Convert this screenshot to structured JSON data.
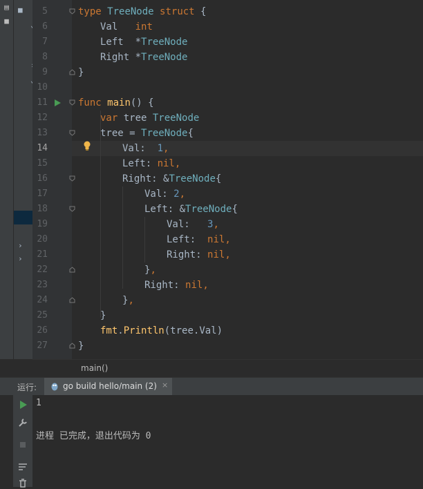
{
  "editor": {
    "lines": [
      {
        "n": "5"
      },
      {
        "n": "6"
      },
      {
        "n": "7"
      },
      {
        "n": "8"
      },
      {
        "n": "9"
      },
      {
        "n": "10"
      },
      {
        "n": "11"
      },
      {
        "n": "12"
      },
      {
        "n": "13"
      },
      {
        "n": "14"
      },
      {
        "n": "15"
      },
      {
        "n": "16"
      },
      {
        "n": "17"
      },
      {
        "n": "18"
      },
      {
        "n": "19"
      },
      {
        "n": "20"
      },
      {
        "n": "21"
      },
      {
        "n": "22"
      },
      {
        "n": "23"
      },
      {
        "n": "24"
      },
      {
        "n": "25"
      },
      {
        "n": "26"
      },
      {
        "n": "27"
      }
    ],
    "tokens": {
      "t_type": "type",
      "t_treenode": "TreeNode",
      "t_struct": "struct",
      "t_lbrace": " {",
      "f_val": "Val",
      "f_int": "int",
      "f_left": "Left",
      "ptr": "*",
      "f_right": "Right",
      "close": "}",
      "k_func": "func",
      "fn_main": "main",
      "paren": "() {",
      "k_var": "var",
      "v_tree": " tree ",
      "assign": "tree = ",
      "lit_open": "{",
      "val1_key": "Val:  ",
      "val1_num": "1",
      "comma": ",",
      "left_key": "Left: ",
      "nil": "nil",
      "right_key": "Right: ",
      "amp": "&",
      "val2_key": "Val: ",
      "val2_num": "2",
      "left2_key": "Left: ",
      "val3_key": "Val:   ",
      "val3_num": "3",
      "left3_key": "Left:  ",
      "right3_key": "Right: ",
      "close_comma": "},",
      "right2_key": "Right: ",
      "fmt": "fmt",
      "dot": ".",
      "println": "Println",
      "args": "(tree.Val)"
    }
  },
  "breadcrumb": {
    "item": "main()"
  },
  "run_panel": {
    "label": "运行:",
    "tab_label": "go build hello/main (2)",
    "tab_close": "×"
  },
  "console": {
    "output_line": "1",
    "exit_message": "进程 已完成，退出代码为 0"
  },
  "colors": {
    "keyword": "#cc7832",
    "type": "#6fafbd",
    "function": "#ffc66d",
    "number": "#6897bb",
    "text": "#a9b7c6",
    "run_green": "#499c54",
    "bulb": "#f0b64a"
  },
  "icons": {
    "run": "run-icon",
    "wrench": "wrench-icon",
    "stop": "stop-icon",
    "soft_wrap": "soft-wrap-icon",
    "trash": "trash-icon",
    "gopher": "gopher-icon",
    "lightbulb": "lightbulb-icon"
  }
}
